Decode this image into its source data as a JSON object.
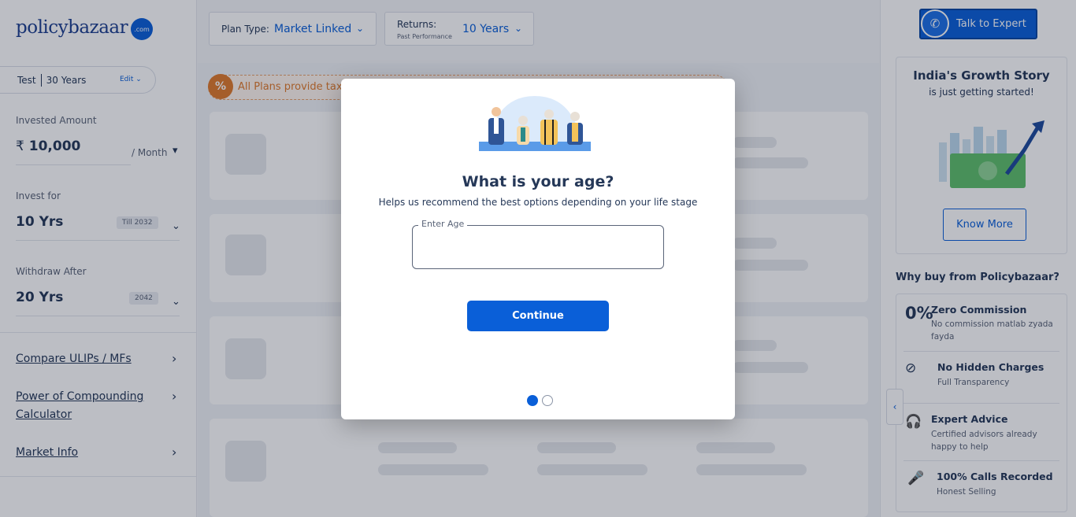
{
  "brand": {
    "logo_text": "policybazaar",
    "logo_badge": ".com"
  },
  "sidebar": {
    "profile": {
      "name": "Test",
      "age": "30 Years",
      "edit_label": "Edit"
    },
    "invested": {
      "label": "Invested Amount",
      "currency": "₹",
      "value": "10,000",
      "frequency": "/ Month"
    },
    "invest_for": {
      "label": "Invest for",
      "value": "10 Yrs",
      "chip": "Till 2032"
    },
    "withdraw": {
      "label": "Withdraw After",
      "value": "20 Yrs",
      "chip": "2042"
    },
    "links": [
      {
        "label": "Compare ULIPs / MFs"
      },
      {
        "label": "Power of Compounding Calculator"
      },
      {
        "label": "Market Info"
      }
    ]
  },
  "filters": {
    "plan_type": {
      "label": "Plan Type:",
      "value": "Market Linked"
    },
    "returns": {
      "label": "Returns:",
      "sub": "Past Performance",
      "value": "10 Years"
    }
  },
  "banner": {
    "text": "All Plans provide tax"
  },
  "right_panel": {
    "expert_button": "Talk to Expert",
    "growth": {
      "title": "India's Growth Story",
      "subtitle": "is just getting started!",
      "button": "Know More"
    },
    "why_title": "Why buy from Policybazaar?",
    "why_items": [
      {
        "title": "Zero Commission",
        "subtitle": "No commission matlab zyada fayda",
        "icon": "zero-percent-icon"
      },
      {
        "title": "No Hidden Charges",
        "subtitle": "Full Transparency",
        "icon": "no-rupee-icon"
      },
      {
        "title": "Expert Advice",
        "subtitle": "Certified advisors already happy to help",
        "icon": "headset-icon"
      },
      {
        "title": "100% Calls Recorded",
        "subtitle": "Honest Selling",
        "icon": "microphone-icon"
      }
    ]
  },
  "modal": {
    "title": "What is your age?",
    "subtitle": "Helps us recommend the best options depending on your life stage",
    "input_label": "Enter Age",
    "input_value": "",
    "continue_label": "Continue",
    "steps_total": 2,
    "step_current": 1
  },
  "colors": {
    "brand_blue": "#0a5fd8",
    "text_dark": "#253858",
    "accent_orange": "#e07a2c"
  }
}
